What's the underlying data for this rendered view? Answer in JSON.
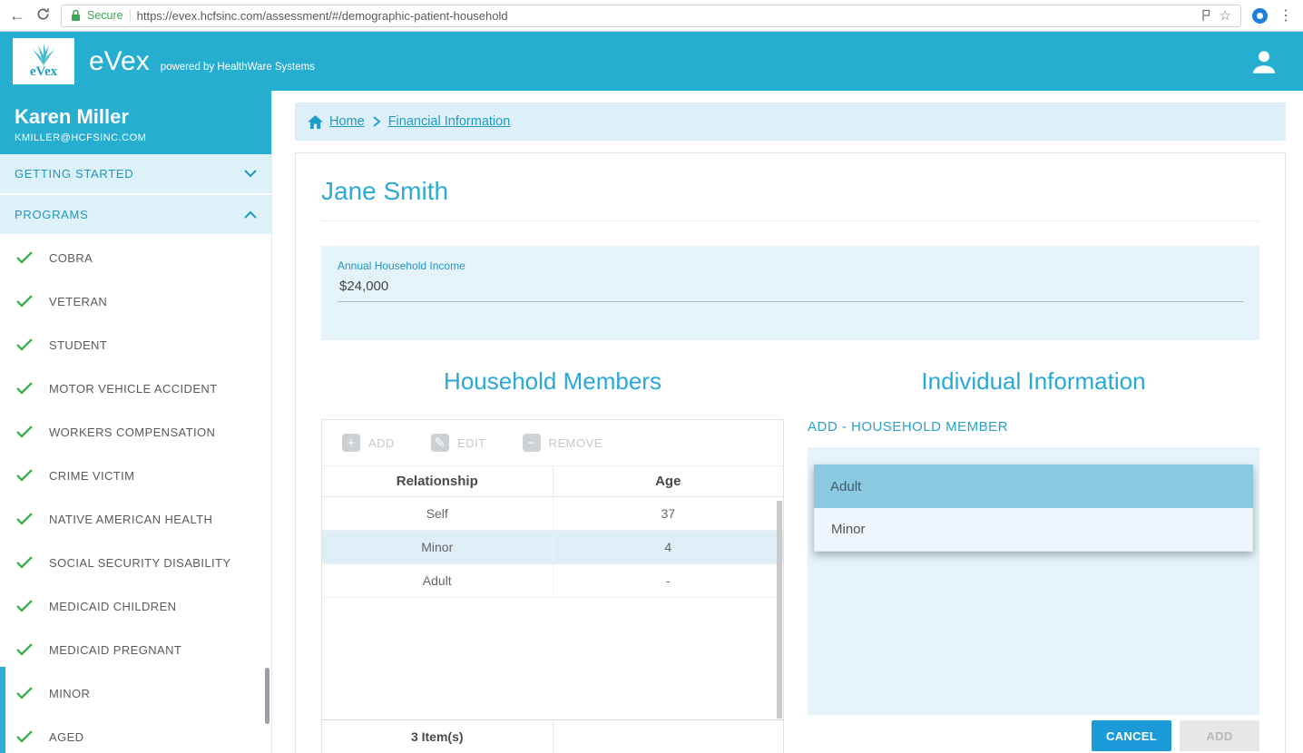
{
  "browser": {
    "secure_label": "Secure",
    "url": "https://evex.hcfsinc.com/assessment/#/demographic-patient-household"
  },
  "header": {
    "logo_text": "eVex",
    "brand": "eVex",
    "powered_by": "powered by HealthWare Systems"
  },
  "sidebar": {
    "user_name": "Karen Miller",
    "user_email": "KMILLER@HCFSINC.COM",
    "sections": {
      "getting_started": "GETTING STARTED",
      "programs": "PROGRAMS"
    },
    "programs": [
      "COBRA",
      "VETERAN",
      "STUDENT",
      "MOTOR VEHICLE ACCIDENT",
      "WORKERS COMPENSATION",
      "CRIME VICTIM",
      "NATIVE AMERICAN HEALTH",
      "SOCIAL SECURITY DISABILITY",
      "MEDICAID CHILDREN",
      "MEDICAID PREGNANT",
      "MINOR",
      "AGED"
    ]
  },
  "breadcrumb": {
    "home": "Home",
    "current": "Financial Information"
  },
  "main": {
    "patient_name": "Jane Smith",
    "income_label": "Annual Household Income",
    "income_value": "$24,000",
    "household": {
      "title": "Household Members",
      "toolbar": {
        "add": "ADD",
        "edit": "EDIT",
        "remove": "REMOVE"
      },
      "columns": [
        "Relationship",
        "Age"
      ],
      "rows": [
        {
          "relationship": "Self",
          "age": "37"
        },
        {
          "relationship": "Minor",
          "age": "4"
        },
        {
          "relationship": "Adult",
          "age": "-"
        }
      ],
      "selected_row_index": 1,
      "footer": "3 Item(s)"
    },
    "individual": {
      "title": "Individual Information",
      "subtitle": "ADD - HOUSEHOLD MEMBER",
      "options": [
        "Adult",
        "Minor"
      ],
      "selected_option": "Adult",
      "cancel_label": "CANCEL",
      "add_label": "ADD"
    }
  },
  "colors": {
    "teal_header": "#25aed0",
    "link_teal": "#1e9cc5",
    "heading_teal": "#2aa8d5",
    "panel_blue": "#e4f3fa",
    "selected_option_bg": "#8bc8e1",
    "selected_row_bg": "#ddeef7",
    "check_green": "#3cb34c",
    "primary_button": "#1a9bd7"
  }
}
